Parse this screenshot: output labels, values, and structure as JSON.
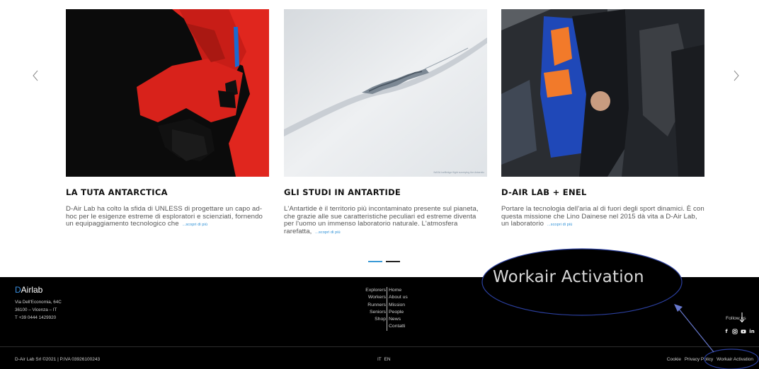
{
  "carousel": {
    "cards": [
      {
        "title": "LA TUTA ANTARCTICA",
        "text": "D-Air Lab ha colto la sfida di UNLESS di progettare un capo ad-hoc per le esigenze estreme di esploratori e scienziati, fornendo un equipaggiamento tecnologico che",
        "more": "...scopri di più"
      },
      {
        "title": "GLI STUDI IN ANTARTIDE",
        "text": "L'Antartide è il territorio più incontaminato presente sul pianeta, che grazie alle sue caratteristiche peculiari ed estreme diventa per l'uomo un immenso laboratorio naturale. L'atmosfera rarefatta,",
        "more": "...scopri di più",
        "image_caption": "NASA IceBridge flight surveying the Antarctic"
      },
      {
        "title": "D-AIR LAB + ENEL",
        "text": "Portare la tecnologia dell'aria al di fuori degli sport dinamici. È con questa missione che Lino Dainese nel 2015 dà vita a D-Air Lab, un laboratorio",
        "more": "...scopri di più"
      }
    ],
    "prev_icon": "chevron-left-icon",
    "next_icon": "chevron-right-icon",
    "active_slide": 1,
    "slide_count": 2
  },
  "footer": {
    "brand_prefix": "D",
    "brand_rest": "Airlab",
    "address": [
      "Via Dell'Economia, 64C",
      "36100 – Vicenza – IT",
      "T +39 0444 1429920"
    ],
    "nav_left": [
      "Explorers",
      "Workers",
      "Runners",
      "Seniors",
      "Shop"
    ],
    "nav_right": [
      "Home",
      "About us",
      "Mission",
      "People",
      "News",
      "Contatti"
    ],
    "follow_label": "Follow us",
    "social": [
      "facebook-icon",
      "instagram-icon",
      "youtube-icon",
      "linkedin-icon"
    ],
    "legal": "D-Air Lab Srl ©2021 | P.IVA 03926100243",
    "lang": [
      "IT",
      "EN"
    ],
    "links": [
      "Cookie",
      "Privacy Policy",
      "Workair Activation"
    ]
  },
  "annotation": {
    "zoom_label": "Workair Activation",
    "accent": "#2b3f9e"
  },
  "colors": {
    "brand_blue": "#3a8fe0",
    "footer_bg": "#000000",
    "more_link": "#2a8fd6"
  }
}
